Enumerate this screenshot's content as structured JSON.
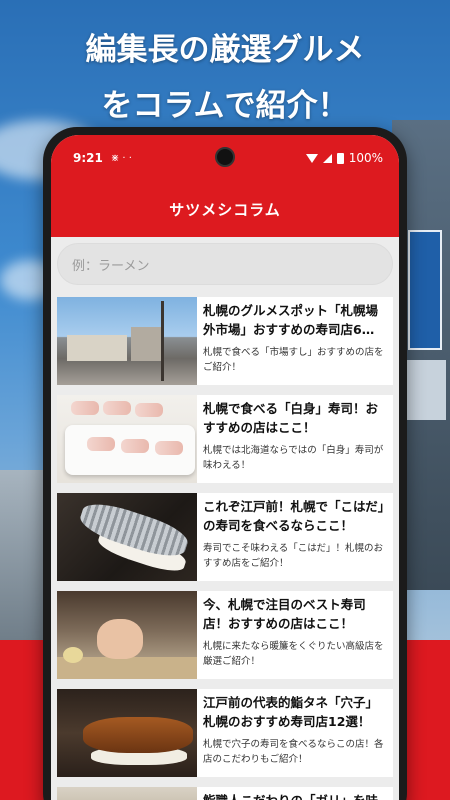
{
  "headline": {
    "line1": "編集長の厳選グルメ",
    "line2": "をコラムで紹介！"
  },
  "status_bar": {
    "time": "9:21",
    "notification_icons": "⋇ ·  ·",
    "battery": "100%"
  },
  "app_bar": {
    "title": "サツメシコラム"
  },
  "search": {
    "placeholder": "例：ラーメン"
  },
  "articles": [
    {
      "title": "札幌のグルメスポット「札幌場外市場」おすすめの寿司店6…",
      "description": "札幌で食べる「市場すし」おすすめの店をご紹介！",
      "thumbnail": "market-street-photo"
    },
    {
      "title": "札幌で食べる「白身」寿司！おすすめの店はここ！",
      "description": "札幌では北海道ならではの「白身」寿司が味わえる！",
      "thumbnail": "white-fish-sushi-photo"
    },
    {
      "title": "これぞ江戸前！札幌で「こはだ」の寿司を食べるならここ！",
      "description": "寿司でこそ味わえる「こはだ」！札幌のおすすめ店をご紹介！",
      "thumbnail": "kohada-sushi-photo"
    },
    {
      "title": "今、札幌で注目のベスト寿司店！おすすめの店はここ！",
      "description": "札幌に来たなら暖簾をくぐりたい高級店を厳選ご紹介！",
      "thumbnail": "chef-hand-photo"
    },
    {
      "title": "江戸前の代表的鮨タネ「穴子」札幌のおすすめ寿司店12選！",
      "description": "札幌で穴子の寿司を食べるならこの店！各店のこだわりもご紹介！",
      "thumbnail": "anago-sushi-photo"
    },
    {
      "title": "鮨職人こだわりの「ガリ」を味",
      "description": "",
      "thumbnail": "gari-photo"
    }
  ]
}
